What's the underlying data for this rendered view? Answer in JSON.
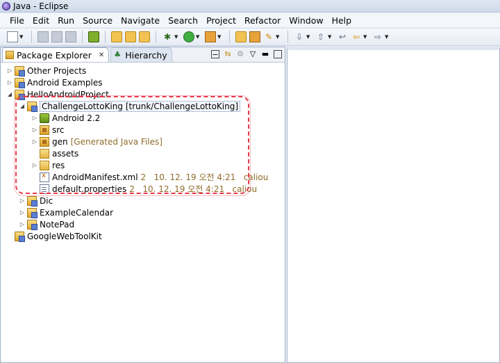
{
  "window": {
    "title": "Java - Eclipse"
  },
  "menu": [
    "File",
    "Edit",
    "Run",
    "Source",
    "Navigate",
    "Search",
    "Project",
    "Refactor",
    "Window",
    "Help"
  ],
  "toolbar_icons": [
    "new-icon",
    "save-icon",
    "save-all-icon",
    "print-icon",
    "android-sdk-icon",
    "new-java-project-icon",
    "new-package-icon",
    "new-class-icon",
    "debug-icon",
    "run-icon",
    "external-tools-icon",
    "new-java-class-icon",
    "open-type-icon",
    "search-icon",
    "next-annotation-icon",
    "prev-annotation-icon",
    "last-edit-icon",
    "back-icon",
    "forward-icon"
  ],
  "tabs": {
    "package_explorer": "Package Explorer",
    "hierarchy": "Hierarchy"
  },
  "tree": {
    "other_projects": "Other Projects",
    "android_examples": "Android Examples",
    "hello_android_project": "HelloAndroidProject",
    "challenge": {
      "name": "ChallengeLottoKing",
      "repo": "[trunk/ChallengeLottoKing]"
    },
    "android22": "Android 2.2",
    "src": "src",
    "gen": {
      "name": "gen",
      "note": "[Generated Java Files]"
    },
    "assets": "assets",
    "res": "res",
    "manifest": {
      "name": "AndroidManifest.xml",
      "info": "2   10. 12. 19 오전 4:21   caliou"
    },
    "default_props": {
      "name": "default.properties",
      "info": "2   10. 12. 19 오전 4:21   caliou"
    },
    "dic": "Dic",
    "example_calendar": "ExampleCalendar",
    "notepad": "NotePad",
    "gwt": "GoogleWebToolKit"
  },
  "colors": {
    "annotation": "#e8394a",
    "decoration": "#8f6b2a"
  }
}
